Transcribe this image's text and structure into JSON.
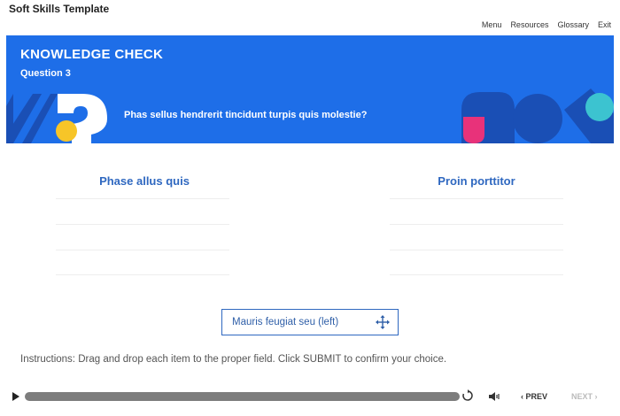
{
  "app": {
    "title": "Soft Skills Template"
  },
  "nav": {
    "menu": "Menu",
    "resources": "Resources",
    "glossary": "Glossary",
    "exit": "Exit"
  },
  "banner": {
    "title": "KNOWLEDGE CHECK",
    "subtitle": "Question 3",
    "question": "Phas sellus hendrerit tincidunt turpis quis molestie?",
    "colors": {
      "background": "#1e6ee8",
      "dark_blue": "#1a4fb5",
      "yellow": "#f7c528",
      "pink": "#e8327a",
      "teal": "#3cc3d0"
    }
  },
  "columns": {
    "left": "Phase allus quis",
    "right": "Proin porttitor"
  },
  "drag_item": {
    "label": "Mauris feugiat seu (left)",
    "icon": "move-icon"
  },
  "instructions": "Instructions: Drag and drop each item to the proper field. Click SUBMIT to confirm your choice.",
  "player": {
    "prev": "PREV",
    "next": "NEXT",
    "progress": 1.0
  }
}
